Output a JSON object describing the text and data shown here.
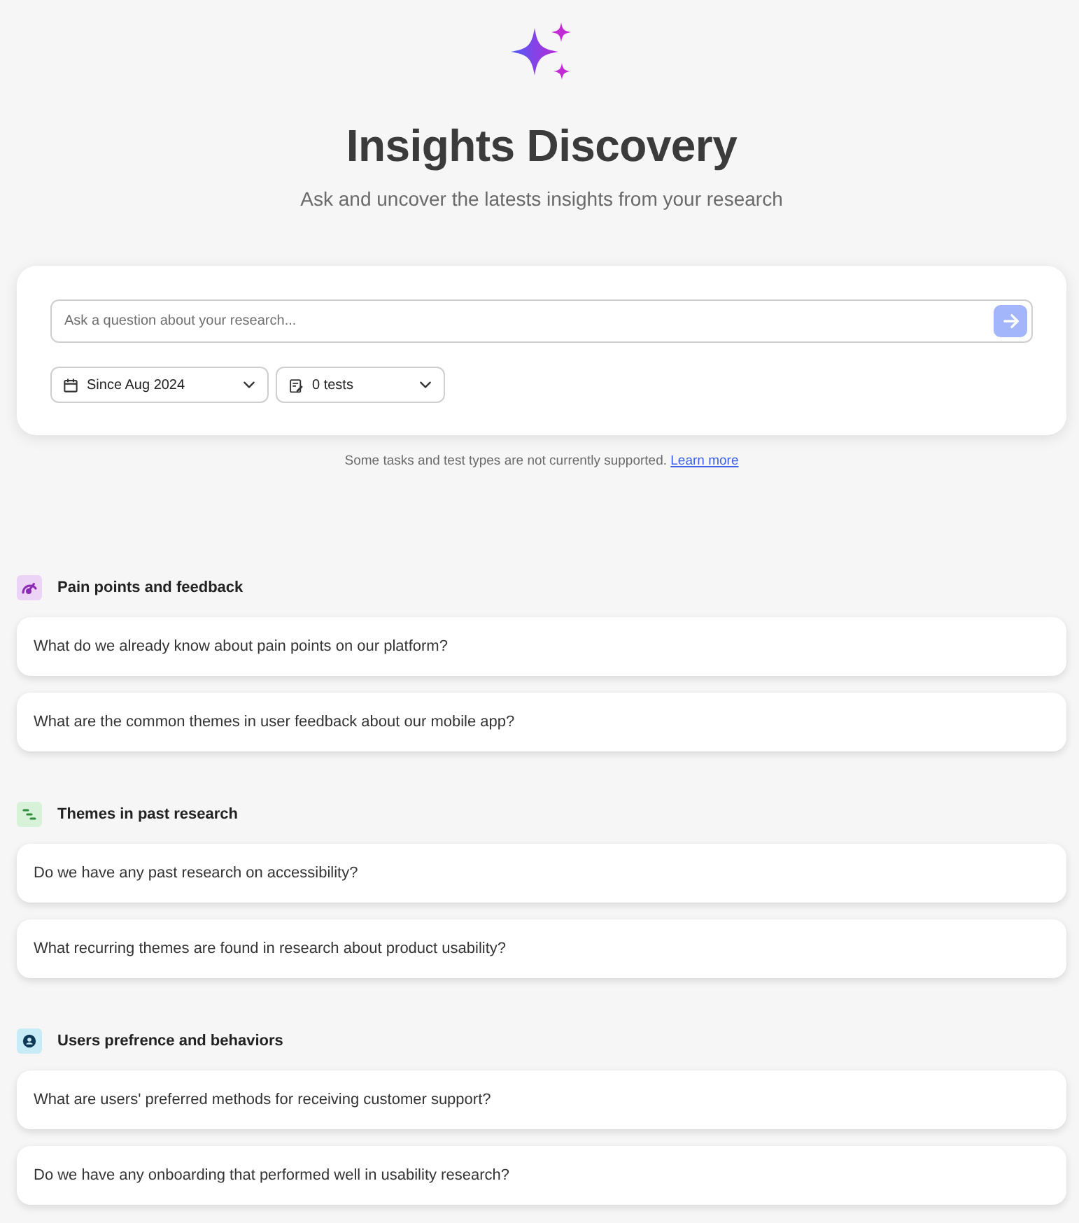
{
  "header": {
    "title": "Insights Discovery",
    "subtitle": "Ask and uncover the latests insights from your research"
  },
  "search": {
    "placeholder": "Ask a question about your research...",
    "send_button": {
      "disabled": true
    },
    "filters": [
      {
        "kind": "date",
        "label": "Since Aug 2024"
      },
      {
        "kind": "tests",
        "label": "0 tests"
      }
    ]
  },
  "notice": {
    "text": "Some tasks and test types are not currently supported.",
    "link": "Learn more"
  },
  "sections": [
    {
      "kind": "pain",
      "title": "Pain points and feedback",
      "questions": [
        "What do we already know about pain points on our platform?",
        "What are the common themes in user feedback about our mobile app?"
      ]
    },
    {
      "kind": "themes",
      "title": "Themes in past research",
      "questions": [
        "Do we have any past research on accessibility?",
        "What recurring themes are found in research about product usability?"
      ]
    },
    {
      "kind": "users",
      "title": "Users prefrence and behaviors",
      "questions": [
        "What are users' preferred methods for receiving customer support?",
        "Do we have any onboarding that performed well in usability research?"
      ]
    }
  ]
}
